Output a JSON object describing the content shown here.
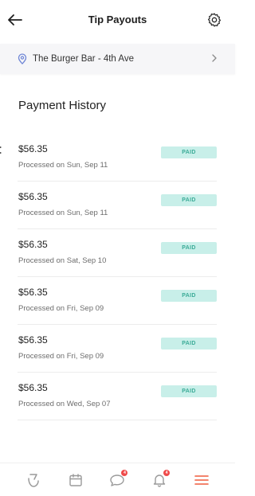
{
  "header": {
    "title": "Tip Payouts",
    "back_icon": "arrow-left-icon",
    "settings_icon": "gear-icon"
  },
  "location": {
    "name": "The Burger Bar - 4th Ave",
    "icon": "map-pin-icon",
    "chevron_icon": "chevron-right-icon"
  },
  "section": {
    "title": "Payment History"
  },
  "payments": [
    {
      "amount": "$56.35",
      "processed": "Processed on Sun, Sep 11",
      "status": "PAID"
    },
    {
      "amount": "$56.35",
      "processed": "Processed on Sun, Sep 11",
      "status": "PAID"
    },
    {
      "amount": "$56.35",
      "processed": "Processed on Sat, Sep 10",
      "status": "PAID"
    },
    {
      "amount": "$56.35",
      "processed": "Processed on Fri, Sep 09",
      "status": "PAID"
    },
    {
      "amount": "$56.35",
      "processed": "Processed on Fri, Sep 09",
      "status": "PAID"
    },
    {
      "amount": "$56.35",
      "processed": "Processed on Wed, Sep 07",
      "status": "PAID"
    }
  ],
  "bottom_nav": {
    "items": [
      {
        "icon": "brand-logo-icon"
      },
      {
        "icon": "calendar-icon"
      },
      {
        "icon": "chat-icon",
        "badge": "4"
      },
      {
        "icon": "bell-icon",
        "badge": "4"
      },
      {
        "icon": "menu-icon",
        "active": true
      }
    ]
  },
  "colors": {
    "paid_badge_bg": "#c8efe9",
    "paid_badge_text": "#3aab97",
    "active_accent": "#ef5b3d",
    "notification_badge": "#ef4a4a",
    "location_bar_bg": "#f6f6f8"
  }
}
